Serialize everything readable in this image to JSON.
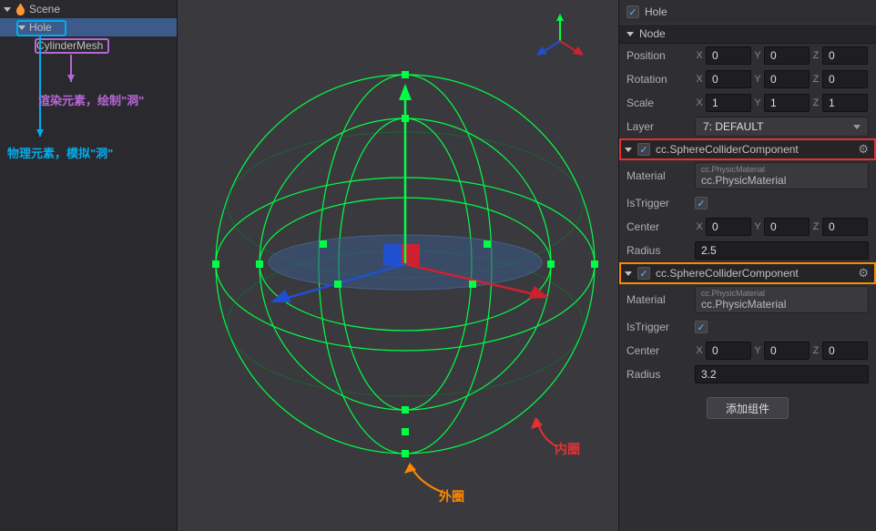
{
  "hierarchy": {
    "root": "Scene",
    "child": "Hole",
    "grandchild": "CylinderMesh"
  },
  "annotations": {
    "render_note": "渲染元素，绘制\"洞\"",
    "physics_note": "物理元素，模拟\"洞\"",
    "outer_circle": "外圈",
    "inner_circle": "内圈"
  },
  "inspector": {
    "node_name": "Hole",
    "node_section": "Node",
    "position": {
      "label": "Position",
      "x": "0",
      "y": "0",
      "z": "0"
    },
    "rotation": {
      "label": "Rotation",
      "x": "0",
      "y": "0",
      "z": "0"
    },
    "scale": {
      "label": "Scale",
      "x": "1",
      "y": "1",
      "z": "1"
    },
    "layer": {
      "label": "Layer",
      "value": "7: DEFAULT"
    },
    "comp1": {
      "title": "cc.SphereColliderComponent",
      "material": {
        "label": "Material",
        "type": "cc.PhysicMaterial",
        "value": "cc.PhysicMaterial"
      },
      "is_trigger": {
        "label": "IsTrigger"
      },
      "center": {
        "label": "Center",
        "x": "0",
        "y": "0",
        "z": "0"
      },
      "radius": {
        "label": "Radius",
        "value": "2.5"
      }
    },
    "comp2": {
      "title": "cc.SphereColliderComponent",
      "material": {
        "label": "Material",
        "type": "cc.PhysicMaterial",
        "value": "cc.PhysicMaterial"
      },
      "is_trigger": {
        "label": "IsTrigger"
      },
      "center": {
        "label": "Center",
        "x": "0",
        "y": "0",
        "z": "0"
      },
      "radius": {
        "label": "Radius",
        "value": "3.2"
      }
    },
    "add_component": "添加组件"
  }
}
